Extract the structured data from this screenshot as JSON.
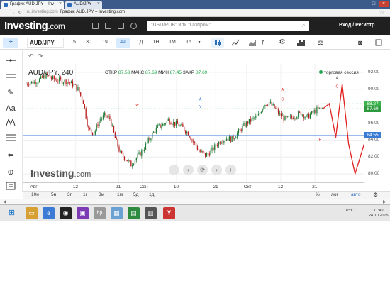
{
  "browser": {
    "tabs": [
      {
        "label": "График AUD JPY – Inv"
      },
      {
        "label": "AUD/JPY"
      }
    ],
    "url_prefix": "ru.investing.com",
    "url_title": "График AUD.JPY – Investing.com"
  },
  "site": {
    "logo_main": "Investing",
    "logo_suffix": ".com",
    "search_placeholder": "\"USD/RUB\" или \"Газпром\"",
    "login_label": "Вход / Регистр"
  },
  "toolbar": {
    "symbol": "AUD/JPY",
    "intervals": [
      "5",
      "30",
      "1ч.",
      "4ч.",
      "1Д",
      "1Н",
      "1М"
    ],
    "active_interval": "4ч.",
    "chart_type_value": "15"
  },
  "chart_header": {
    "title": "AUD/JPY, 240,",
    "open_label": "ОТКР",
    "open_value": "87.53",
    "high_label": "МАКС",
    "high_value": "87.69",
    "low_label": "МИН",
    "low_value": "87.45",
    "close_label": "ЗАКР",
    "close_value": "87.69",
    "session_label": "торговая сессия"
  },
  "watermark": {
    "main": "Investing",
    "suffix": ".com"
  },
  "colors": {
    "up_candle": "#1f7a35",
    "down_candle": "#b81d1d",
    "price_line_green": "#3bb34a",
    "price_line_blue": "#3a7bd5",
    "projection": "#e02020",
    "site_header": "#202020"
  },
  "chart_data": {
    "type": "candlestick",
    "title": "AUD/JPY, 240,",
    "y_ticks": [
      "92.00",
      "90.00",
      "88.00",
      "86.00",
      "84.00",
      "82.00",
      "80.00"
    ],
    "price_labels": [
      {
        "value": "88.27"
      },
      {
        "value": "87.69"
      },
      {
        "value": "84.55"
      }
    ],
    "x_ticks": [
      "Авг",
      "12",
      "21",
      "Сен",
      "10",
      "21",
      "Окт",
      "12",
      "21"
    ],
    "ylim": [
      79,
      93
    ],
    "close_path": [
      90.6,
      90.8,
      90.9,
      91.2,
      91.7,
      91.3,
      91.1,
      91.0,
      90.9,
      90.6,
      90.0,
      88.5,
      85.2,
      84.8,
      86.3,
      86.9,
      86.5,
      84.2,
      82.4,
      81.8,
      81.1,
      81.9,
      82.6,
      83.6,
      84.7,
      85.5,
      85.8,
      86.4,
      86.0,
      85.8,
      85.3,
      84.6,
      83.5,
      82.6,
      82.2,
      82.6,
      83.4,
      84.0,
      84.2,
      84.1,
      84.8,
      85.5,
      86.1,
      86.5,
      86.9,
      88.2,
      88.4,
      87.8,
      87.0,
      86.5,
      86.6,
      86.9,
      87.2,
      86.7,
      87.1,
      87.6,
      87.7
    ],
    "annotations": [
      {
        "text": "4",
        "x": "after-21-oct",
        "y": 91.2
      },
      {
        "text": "A",
        "x": "12-oct",
        "y": 89.8
      },
      {
        "text": "C",
        "x": "12-oct",
        "y": 88.7
      },
      {
        "text": "A",
        "x": "10-sep",
        "y": 88.7
      },
      {
        "text": "Y",
        "x": "10-sep",
        "y": 87.8
      },
      {
        "text": "w",
        "x": "21-aug",
        "y": 88.0
      },
      {
        "text": "C",
        "x": "after-21-oct",
        "y": 90.2
      },
      {
        "text": "B",
        "x": "21-oct",
        "y": 83.9
      }
    ],
    "projection_path": [
      87.7,
      88.3,
      84.3,
      90.6,
      83.5,
      80.0,
      82.5,
      85.0,
      80.5
    ],
    "grid": true
  },
  "x_axis": {
    "periods": [
      "10н",
      "5н",
      "3г",
      "1г",
      "3м",
      "1м",
      "5д",
      "1д"
    ],
    "date_labels": [
      "7д",
      "1д"
    ],
    "log_label": "лог",
    "auto_label": "авто",
    "pct_label": "%"
  },
  "taskbar": {
    "lang": "РУС",
    "time": "11:40",
    "date": "24.10.2015"
  }
}
